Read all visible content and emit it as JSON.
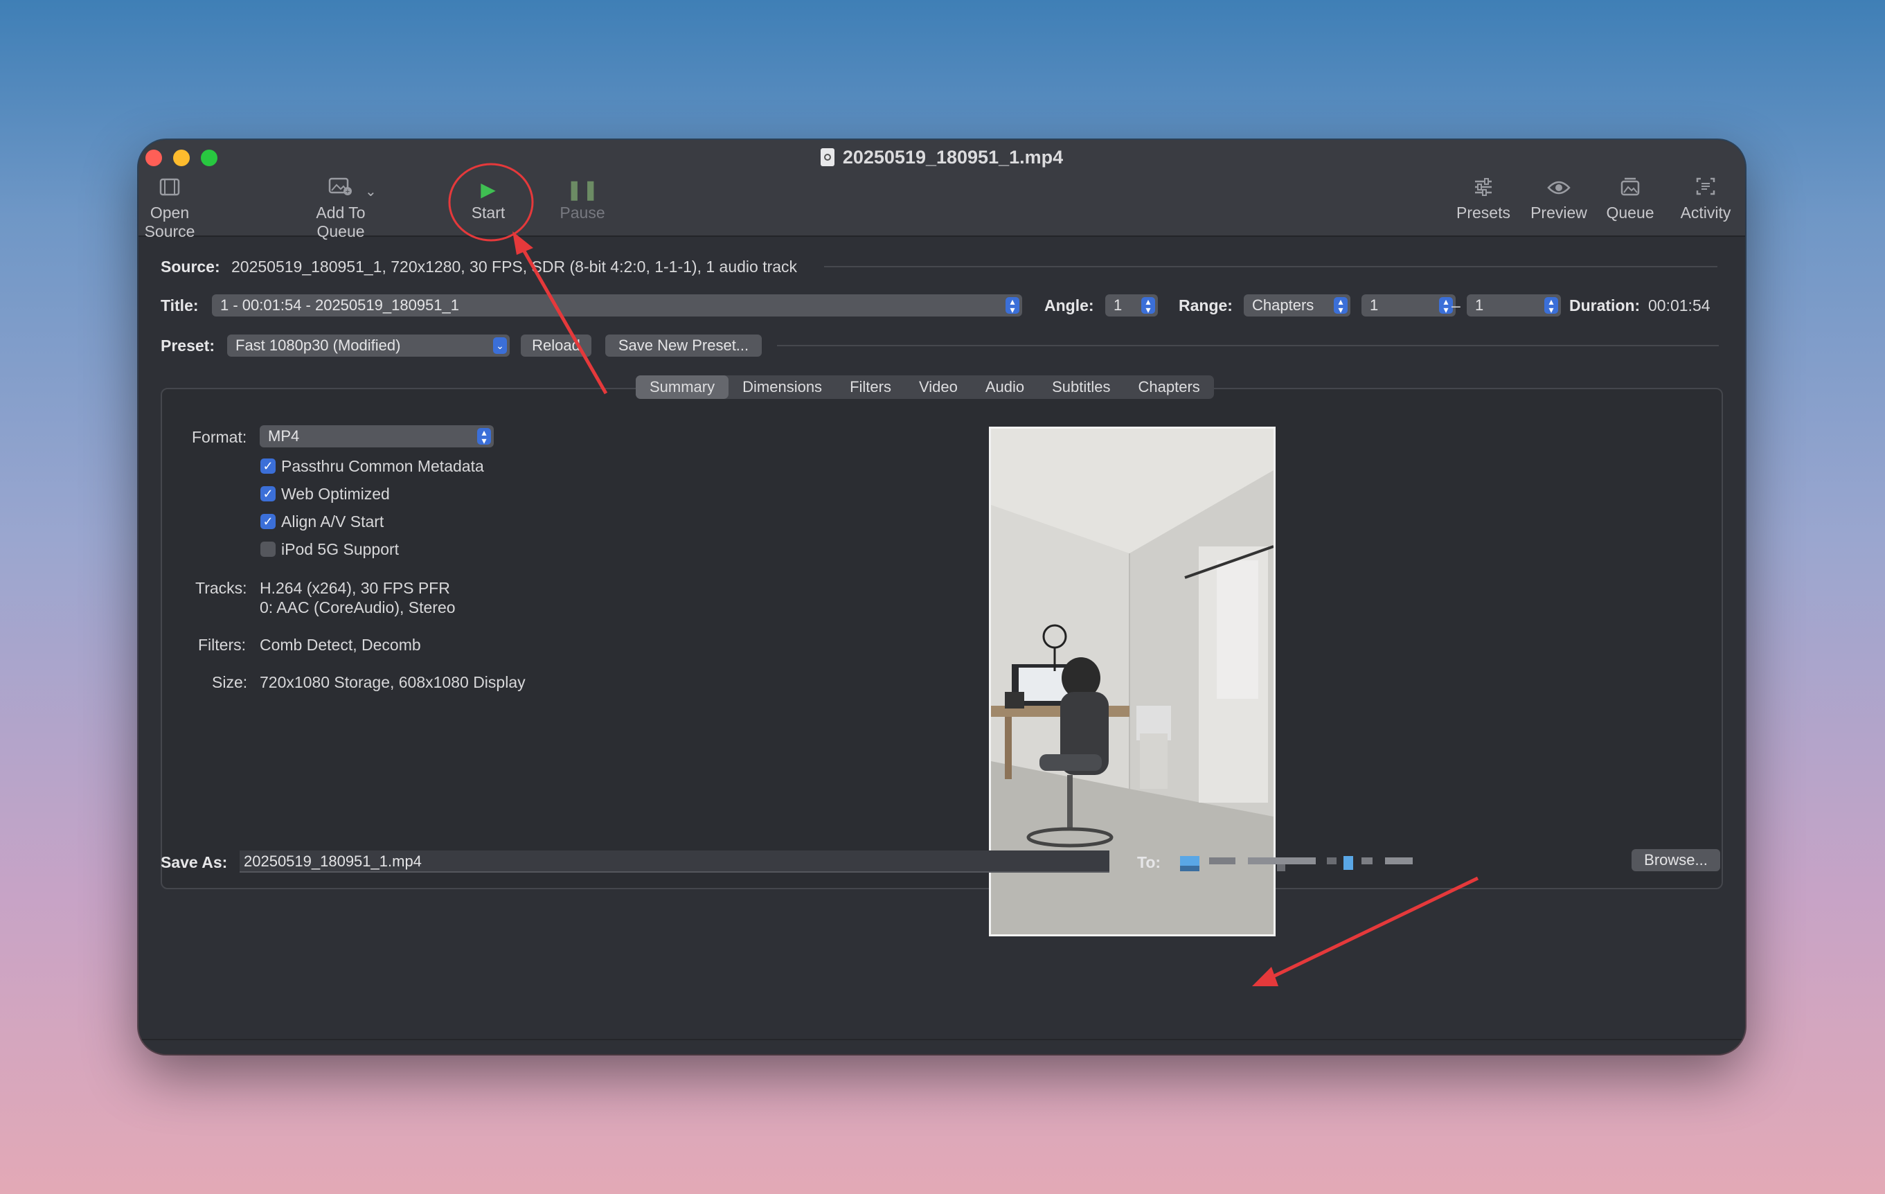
{
  "window": {
    "title": "20250519_180951_1.mp4"
  },
  "toolbar": {
    "open_source": "Open Source",
    "add_to_queue": "Add To Queue",
    "start": "Start",
    "pause": "Pause",
    "presets": "Presets",
    "preview": "Preview",
    "queue": "Queue",
    "activity": "Activity"
  },
  "source": {
    "label": "Source:",
    "value": "20250519_180951_1, 720x1280, 30 FPS, SDR (8-bit 4:2:0, 1-1-1), 1 audio track"
  },
  "title_row": {
    "label": "Title:",
    "value": "1 - 00:01:54 - 20250519_180951_1",
    "angle_label": "Angle:",
    "angle_value": "1",
    "range_label": "Range:",
    "range_value": "Chapters",
    "range_start": "1",
    "range_dash": "–",
    "range_end": "1",
    "duration_label": "Duration:",
    "duration_value": "00:01:54"
  },
  "preset": {
    "label": "Preset:",
    "value": "Fast 1080p30 (Modified)",
    "reload": "Reload",
    "save_new": "Save New Preset..."
  },
  "tabs": [
    "Summary",
    "Dimensions",
    "Filters",
    "Video",
    "Audio",
    "Subtitles",
    "Chapters"
  ],
  "summary": {
    "format_label": "Format:",
    "format_value": "MP4",
    "options": [
      {
        "label": "Passthru Common Metadata",
        "checked": true
      },
      {
        "label": "Web Optimized",
        "checked": true
      },
      {
        "label": "Align A/V Start",
        "checked": true
      },
      {
        "label": "iPod 5G Support",
        "checked": false
      }
    ],
    "tracks_label": "Tracks:",
    "tracks_line1": "H.264 (x264), 30 FPS PFR",
    "tracks_line2": "0: AAC (CoreAudio), Stereo",
    "filters_label": "Filters:",
    "filters_value": "Comb Detect, Decomb",
    "size_label": "Size:",
    "size_value": "720x1080 Storage, 608x1080 Display"
  },
  "save": {
    "label": "Save As:",
    "value": "20250519_180951_1.mp4",
    "to_label": "To:",
    "browse": "Browse..."
  },
  "colors": {
    "accent": "#3b6fd8",
    "annotation": "#e5393b",
    "start_icon": "#3fbf52"
  }
}
